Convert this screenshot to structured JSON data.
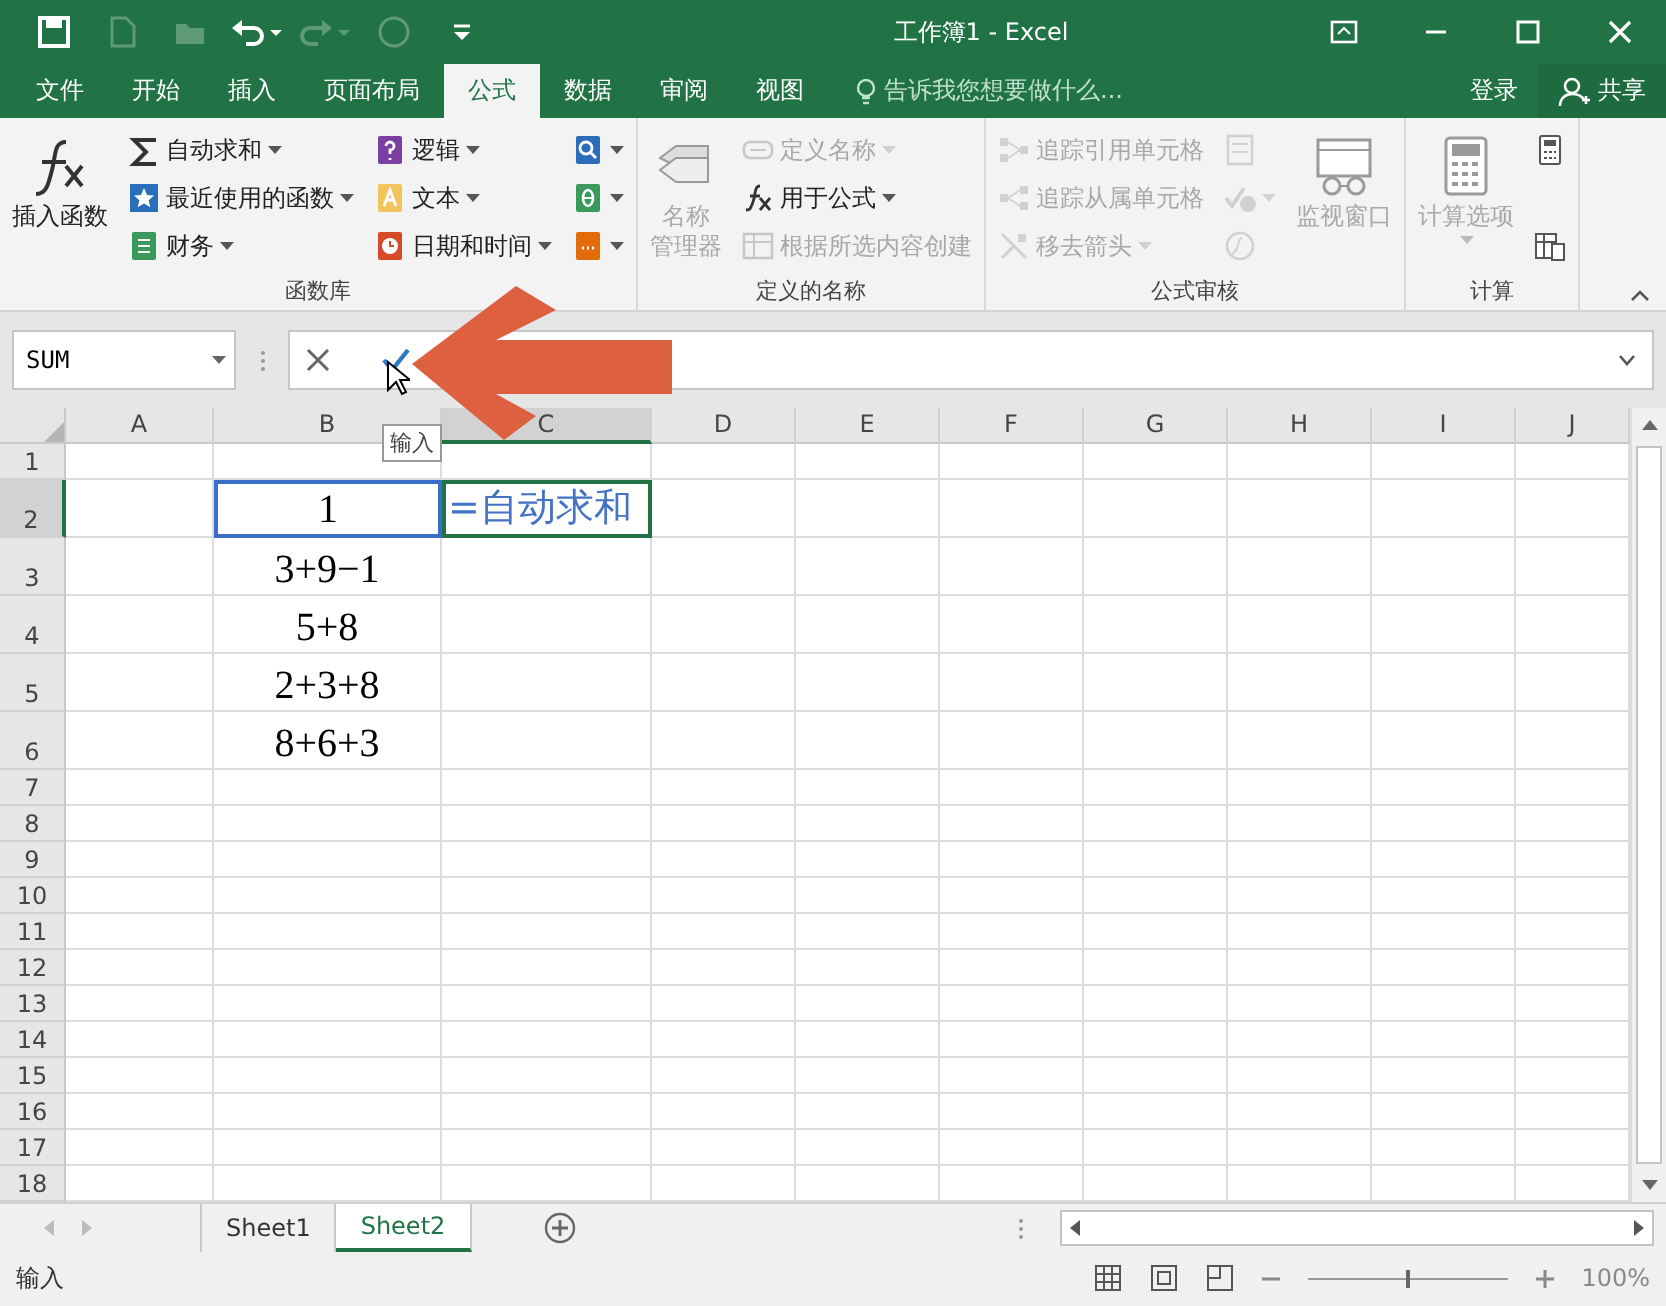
{
  "title_bar": {
    "title": "工作簿1 - Excel",
    "quick_access": [
      {
        "disabled": false
      },
      {
        "disabled": true
      },
      {
        "disabled": true
      },
      {
        "disabled": false
      },
      {
        "disabled": true
      },
      {
        "disabled": true
      },
      {
        "disabled": false
      }
    ]
  },
  "menu_tabs": [
    {
      "label": "文件",
      "selected": false
    },
    {
      "label": "开始",
      "selected": false
    },
    {
      "label": "插入",
      "selected": false
    },
    {
      "label": "页面布局",
      "selected": false
    },
    {
      "label": "公式",
      "selected": true
    },
    {
      "label": "数据",
      "selected": false
    },
    {
      "label": "审阅",
      "selected": false
    },
    {
      "label": "视图",
      "selected": false
    }
  ],
  "tell_me": "告诉我您想要做什么...",
  "sign_in": "登录",
  "share": "共享",
  "ribbon": [
    {
      "label": "函数库",
      "columns": [
        [
          {
            "kind": "large",
            "label": "插入函数",
            "disabled": false,
            "dropdown": false
          }
        ],
        [
          {
            "kind": "small",
            "label": "自动求和",
            "disabled": false,
            "dropdown": true
          },
          {
            "kind": "small",
            "label": "最近使用的函数",
            "disabled": false,
            "dropdown": true
          },
          {
            "kind": "small",
            "label": "财务",
            "disabled": false,
            "dropdown": true
          }
        ],
        [
          {
            "kind": "small",
            "label": "逻辑",
            "disabled": false,
            "dropdown": true
          },
          {
            "kind": "small",
            "label": "文本",
            "disabled": false,
            "dropdown": true
          },
          {
            "kind": "small",
            "label": "日期和时间",
            "disabled": false,
            "dropdown": true
          }
        ],
        [
          {
            "kind": "icon",
            "disabled": false,
            "dropdown": true
          },
          {
            "kind": "icon",
            "disabled": false,
            "dropdown": true
          },
          {
            "kind": "icon",
            "disabled": false,
            "dropdown": true
          }
        ]
      ]
    },
    {
      "label": "定义的名称",
      "columns": [
        [
          {
            "kind": "large",
            "label": [
              "名称",
              "管理器"
            ],
            "disabled": true,
            "dropdown": false
          }
        ],
        [
          {
            "kind": "small",
            "label": "定义名称",
            "disabled": true,
            "dropdown": true
          },
          {
            "kind": "small",
            "label": "用于公式",
            "disabled": false,
            "dropdown": true
          },
          {
            "kind": "small",
            "label": "根据所选内容创建",
            "disabled": true,
            "dropdown": false
          }
        ]
      ]
    },
    {
      "label": "公式审核",
      "columns": [
        [
          {
            "kind": "small",
            "label": "追踪引用单元格",
            "disabled": true,
            "dropdown": false
          },
          {
            "kind": "small",
            "label": "追踪从属单元格",
            "disabled": true,
            "dropdown": false
          },
          {
            "kind": "small",
            "label": "移去箭头",
            "disabled": true,
            "dropdown": true
          }
        ],
        [
          {
            "kind": "icon",
            "disabled": true,
            "dropdown": false
          },
          {
            "kind": "icon",
            "disabled": true,
            "dropdown": true
          },
          {
            "kind": "icon",
            "disabled": true,
            "dropdown": false
          }
        ],
        [
          {
            "kind": "large",
            "label": "监视窗口",
            "disabled": true,
            "dropdown": false
          }
        ]
      ]
    },
    {
      "label": "计算",
      "columns": [
        [
          {
            "kind": "large",
            "label": "计算选项",
            "disabled": true,
            "dropdown": true
          }
        ],
        [
          {
            "kind": "icon",
            "disabled": false,
            "dropdown": false
          },
          {
            "kind": "icon",
            "disabled": false,
            "dropdown": false
          }
        ]
      ]
    }
  ],
  "formula_bar": {
    "name_box": "SUM"
  },
  "tooltip": "输入",
  "grid": {
    "columns": [
      {
        "label": "A",
        "selected": false
      },
      {
        "label": "B",
        "selected": false
      },
      {
        "label": "C",
        "selected": true
      },
      {
        "label": "D",
        "selected": false
      },
      {
        "label": "E",
        "selected": false
      },
      {
        "label": "F",
        "selected": false
      },
      {
        "label": "G",
        "selected": false
      },
      {
        "label": "H",
        "selected": false
      },
      {
        "label": "I",
        "selected": false
      },
      {
        "label": "J",
        "selected": false
      }
    ],
    "rows": [
      {
        "header": "1",
        "selected": false
      },
      {
        "header": "2",
        "selected": true,
        "cells": [
          null,
          {
            "text": "1",
            "referenced": true,
            "editing": false
          },
          {
            "text": "=自动求和",
            "referenced": false,
            "editing": true
          }
        ]
      },
      {
        "header": "3",
        "selected": false,
        "cells": [
          null,
          {
            "text": "3+9−1",
            "referenced": false,
            "editing": false
          }
        ]
      },
      {
        "header": "4",
        "selected": false,
        "cells": [
          null,
          {
            "text": "5+8",
            "referenced": false,
            "editing": false
          }
        ]
      },
      {
        "header": "5",
        "selected": false,
        "cells": [
          null,
          {
            "text": "2+3+8",
            "referenced": false,
            "editing": false
          }
        ]
      },
      {
        "header": "6",
        "selected": false,
        "cells": [
          null,
          {
            "text": "8+6+3",
            "referenced": false,
            "editing": false
          }
        ]
      },
      {
        "header": "7",
        "selected": false
      },
      {
        "header": "8",
        "selected": false
      },
      {
        "header": "9",
        "selected": false
      },
      {
        "header": "10",
        "selected": false
      },
      {
        "header": "11",
        "selected": false
      },
      {
        "header": "12",
        "selected": false
      },
      {
        "header": "13",
        "selected": false
      },
      {
        "header": "14",
        "selected": false
      },
      {
        "header": "15",
        "selected": false
      },
      {
        "header": "16",
        "selected": false
      },
      {
        "header": "17",
        "selected": false
      },
      {
        "header": "18",
        "selected": false
      }
    ]
  },
  "sheet_tabs": [
    {
      "label": "Sheet1",
      "selected": false
    },
    {
      "label": "Sheet2",
      "selected": true
    }
  ],
  "status_bar": {
    "mode": "输入",
    "zoom_slider": {
      "level": 0.5
    },
    "zoom": "100%"
  }
}
